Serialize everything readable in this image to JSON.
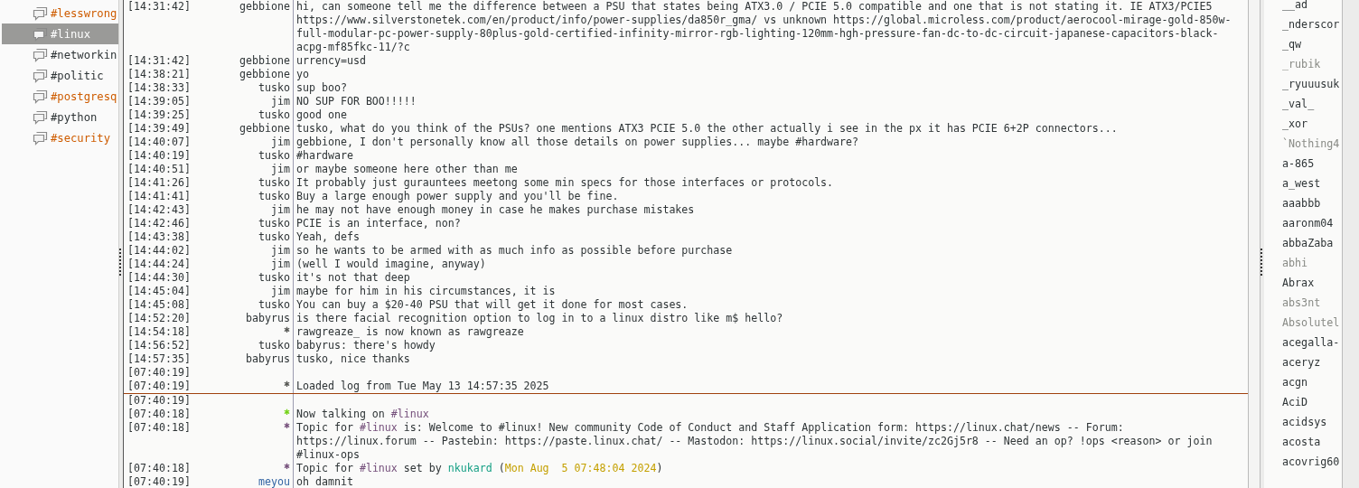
{
  "channels": [
    {
      "name": "#lesswrong",
      "selected": false,
      "unread": true
    },
    {
      "name": "#linux",
      "selected": true,
      "unread": false
    },
    {
      "name": "#networkin",
      "selected": false,
      "unread": false
    },
    {
      "name": "#politic",
      "selected": false,
      "unread": false
    },
    {
      "name": "#postgresq",
      "selected": false,
      "unread": true
    },
    {
      "name": "#python",
      "selected": false,
      "unread": false
    },
    {
      "name": "#security",
      "selected": false,
      "unread": true
    }
  ],
  "rows": [
    {
      "time": "[14:31:42]",
      "nick": "gebbione",
      "color": "#2e3436",
      "text": "hi, can someone tell me the difference between a PSU that states being ATX3.0 / PCIE 5.0 compatible and one that is not stating it. IE ATX3/PCIE5 https://www.silverstonetek.com/en/product/info/power-supplies/da850r_gma/ vs unknown https://global.microless.com/product/aerocool-mirage-gold-850w-full-modular-pc-power-supply-80plus-gold-certified-infinity-mirror-rgb-lighting-120mm-hgh-pressure-fan-dc-to-dc-circuit-japanese-capacitors-black-acpg-mf85fkc-11/?c"
    },
    {
      "time": "[14:31:42]",
      "nick": "gebbione",
      "color": "#2e3436",
      "text": "urrency=usd"
    },
    {
      "time": "[14:38:21]",
      "nick": "gebbione",
      "color": "#2e3436",
      "text": "yo"
    },
    {
      "time": "[14:38:33]",
      "nick": "tusko",
      "color": "#2e3436",
      "text": "sup boo?"
    },
    {
      "time": "[14:39:05]",
      "nick": "jim",
      "color": "#2e3436",
      "text": "NO SUP FOR BOO!!!!!"
    },
    {
      "time": "[14:39:25]",
      "nick": "tusko",
      "color": "#2e3436",
      "text": "good one"
    },
    {
      "time": "[14:39:49]",
      "nick": "gebbione",
      "color": "#2e3436",
      "text": "tusko, what do you think of the PSUs? one mentions ATX3 PCIE 5.0 the other actually i see in the px it has PCIE 6+2P connectors..."
    },
    {
      "time": "[14:40:07]",
      "nick": "jim",
      "color": "#2e3436",
      "text": "gebbione, I don't personally know all those details on power supplies... maybe #hardware?"
    },
    {
      "time": "[14:40:19]",
      "nick": "tusko",
      "color": "#2e3436",
      "text": "#hardware"
    },
    {
      "time": "[14:40:51]",
      "nick": "jim",
      "color": "#2e3436",
      "text": "or maybe someone here other than me"
    },
    {
      "time": "[14:41:26]",
      "nick": "tusko",
      "color": "#2e3436",
      "text": "It probably just gurauntees meetong some min specs for those interfaces or protocols."
    },
    {
      "time": "[14:41:41]",
      "nick": "tusko",
      "color": "#2e3436",
      "text": "Buy a large enough power supply and you'll be fine."
    },
    {
      "time": "[14:42:43]",
      "nick": "jim",
      "color": "#2e3436",
      "text": "he may not have enough money in case he makes purchase mistakes"
    },
    {
      "time": "[14:42:46]",
      "nick": "tusko",
      "color": "#2e3436",
      "text": "PCIE is an interface, non?"
    },
    {
      "time": "[14:43:38]",
      "nick": "tusko",
      "color": "#2e3436",
      "text": "Yeah, defs"
    },
    {
      "time": "[14:44:02]",
      "nick": "jim",
      "color": "#2e3436",
      "text": "so he wants to be armed with as much info as possible before purchase"
    },
    {
      "time": "[14:44:24]",
      "nick": "jim",
      "color": "#2e3436",
      "text": "(well I would imagine, anyway)"
    },
    {
      "time": "[14:44:30]",
      "nick": "tusko",
      "color": "#2e3436",
      "text": "it's not that deep"
    },
    {
      "time": "[14:45:04]",
      "nick": "jim",
      "color": "#2e3436",
      "text": "maybe for him in his circumstances, it is"
    },
    {
      "time": "[14:45:08]",
      "nick": "tusko",
      "color": "#2e3436",
      "text": "You can buy a $20-40 PSU that will get it done for most cases."
    },
    {
      "time": "[14:52:20]",
      "nick": "babyrus",
      "color": "#2e3436",
      "text": "is there facial recognition option to log in to a linux distro like m$ hello?"
    },
    {
      "time": "[14:54:18]",
      "nick": "*",
      "color": "#555753",
      "text": "rawgreaze_ is now known as rawgreaze"
    },
    {
      "time": "[14:56:52]",
      "nick": "tusko",
      "color": "#2e3436",
      "text": "babyrus: there's howdy"
    },
    {
      "time": "[14:57:35]",
      "nick": "babyrus",
      "color": "#2e3436",
      "text": "tusko, nice thanks"
    },
    {
      "time": "[07:40:19]"
    },
    {
      "time": "[07:40:19]",
      "nick": "*",
      "color": "#555753",
      "text": "Loaded log from Tue May 13 14:57:35 2025"
    },
    {
      "time": "[07:40:19]",
      "marker": true
    },
    {
      "time": "[07:40:18]",
      "nick": "*",
      "color": "#73d216",
      "parts": [
        {
          "text": "Now talking on "
        },
        {
          "kind": "channel",
          "text": "#linux"
        }
      ]
    },
    {
      "time": "[07:40:18]",
      "nick": "*",
      "color": "#75507b",
      "parts": [
        {
          "text": "Topic for "
        },
        {
          "kind": "channel",
          "text": "#linux"
        },
        {
          "text": " is: Welcome to #linux! New community Code of Conduct and Staff Application form: https://linux.chat/news -- Forum: https://linux.forum -- Pastebin: https://paste.linux.chat/ -- Mastodon: https://linux.social/invite/zc2Gj5r8 -- Need an op? !ops <reason> or join #linux-ops"
        }
      ]
    },
    {
      "time": "[07:40:18]",
      "nick": "*",
      "color": "#75507b",
      "parts": [
        {
          "text": "Topic for "
        },
        {
          "kind": "channel",
          "text": "#linux"
        },
        {
          "text": " set by "
        },
        {
          "kind": "nick",
          "text": "nkukard"
        },
        {
          "text": " ("
        },
        {
          "kind": "date",
          "text": "Mon Aug  5 07:48:04 2024"
        },
        {
          "text": ")"
        }
      ]
    },
    {
      "time": "[07:40:19]",
      "nick": "meyou",
      "color": "#3465a4",
      "text": "oh damnit"
    }
  ],
  "users": [
    {
      "name": "__ad",
      "away": false
    },
    {
      "name": "_nderscor",
      "away": false
    },
    {
      "name": "_qw",
      "away": false
    },
    {
      "name": "_rubik",
      "away": true
    },
    {
      "name": "_ryuuusuk",
      "away": false
    },
    {
      "name": "_val_",
      "away": false
    },
    {
      "name": "_xor",
      "away": false
    },
    {
      "name": "`Nothing4",
      "away": true
    },
    {
      "name": "a-865",
      "away": false
    },
    {
      "name": "a_west",
      "away": false
    },
    {
      "name": "aaabbb",
      "away": false
    },
    {
      "name": "aaronm04",
      "away": false
    },
    {
      "name": "abbaZaba",
      "away": false
    },
    {
      "name": "abhi",
      "away": true
    },
    {
      "name": "Abrax",
      "away": false
    },
    {
      "name": "abs3nt",
      "away": true
    },
    {
      "name": "Absolutel",
      "away": true
    },
    {
      "name": "acegalla-",
      "away": false
    },
    {
      "name": "aceryz",
      "away": false
    },
    {
      "name": "acgn",
      "away": false
    },
    {
      "name": "AciD",
      "away": false
    },
    {
      "name": "acidsys",
      "away": false
    },
    {
      "name": "acosta",
      "away": false
    },
    {
      "name": "acovrig60",
      "away": false
    }
  ]
}
